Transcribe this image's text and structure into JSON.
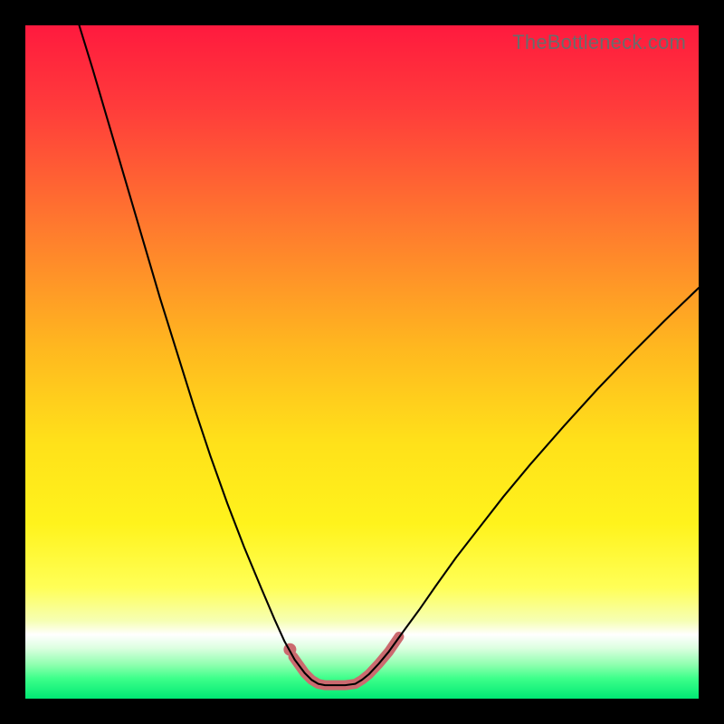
{
  "watermark": "TheBottleneck.com",
  "chart_data": {
    "type": "line",
    "title": "",
    "xlabel": "",
    "ylabel": "",
    "xlim": [
      0,
      100
    ],
    "ylim": [
      0,
      100
    ],
    "grid": false,
    "legend": false,
    "background_gradient_stops": [
      {
        "offset": 0.0,
        "color": "#ff1a3e"
      },
      {
        "offset": 0.12,
        "color": "#ff3b3b"
      },
      {
        "offset": 0.3,
        "color": "#ff7a2e"
      },
      {
        "offset": 0.48,
        "color": "#ffb81f"
      },
      {
        "offset": 0.62,
        "color": "#ffe11a"
      },
      {
        "offset": 0.74,
        "color": "#fff31c"
      },
      {
        "offset": 0.835,
        "color": "#ffff57"
      },
      {
        "offset": 0.885,
        "color": "#f6ffb5"
      },
      {
        "offset": 0.905,
        "color": "#ffffff"
      },
      {
        "offset": 0.925,
        "color": "#dcffe0"
      },
      {
        "offset": 0.95,
        "color": "#8dffae"
      },
      {
        "offset": 0.97,
        "color": "#3dff8a"
      },
      {
        "offset": 1.0,
        "color": "#00e874"
      }
    ],
    "series": [
      {
        "name": "bottleneck-curve",
        "color": "#000000",
        "width": 2.1,
        "data": [
          {
            "x": 8.0,
            "y": 100.0
          },
          {
            "x": 10.0,
            "y": 93.5
          },
          {
            "x": 12.5,
            "y": 85.0
          },
          {
            "x": 15.0,
            "y": 76.5
          },
          {
            "x": 17.5,
            "y": 68.0
          },
          {
            "x": 20.0,
            "y": 59.5
          },
          {
            "x": 22.5,
            "y": 51.5
          },
          {
            "x": 25.0,
            "y": 43.5
          },
          {
            "x": 27.5,
            "y": 36.0
          },
          {
            "x": 30.0,
            "y": 29.0
          },
          {
            "x": 32.5,
            "y": 22.5
          },
          {
            "x": 35.0,
            "y": 16.5
          },
          {
            "x": 37.0,
            "y": 11.8
          },
          {
            "x": 38.5,
            "y": 8.5
          },
          {
            "x": 40.0,
            "y": 5.8
          },
          {
            "x": 41.5,
            "y": 3.8
          },
          {
            "x": 42.5,
            "y": 2.8
          },
          {
            "x": 43.5,
            "y": 2.2
          },
          {
            "x": 44.5,
            "y": 2.0
          },
          {
            "x": 46.0,
            "y": 2.0
          },
          {
            "x": 47.5,
            "y": 2.0
          },
          {
            "x": 49.0,
            "y": 2.2
          },
          {
            "x": 50.0,
            "y": 2.8
          },
          {
            "x": 51.0,
            "y": 3.6
          },
          {
            "x": 52.5,
            "y": 5.2
          },
          {
            "x": 54.0,
            "y": 7.0
          },
          {
            "x": 56.0,
            "y": 9.8
          },
          {
            "x": 58.5,
            "y": 13.2
          },
          {
            "x": 61.0,
            "y": 16.8
          },
          {
            "x": 64.0,
            "y": 21.0
          },
          {
            "x": 67.5,
            "y": 25.5
          },
          {
            "x": 71.0,
            "y": 30.0
          },
          {
            "x": 75.0,
            "y": 34.8
          },
          {
            "x": 80.0,
            "y": 40.5
          },
          {
            "x": 85.0,
            "y": 46.0
          },
          {
            "x": 90.0,
            "y": 51.2
          },
          {
            "x": 95.0,
            "y": 56.2
          },
          {
            "x": 100.0,
            "y": 61.0
          }
        ]
      },
      {
        "name": "highlight-band",
        "color": "#cb6a6f",
        "width": 11,
        "linecap": "round",
        "data": [
          {
            "x": 39.8,
            "y": 6.2
          },
          {
            "x": 41.5,
            "y": 3.8
          },
          {
            "x": 42.5,
            "y": 2.8
          },
          {
            "x": 43.5,
            "y": 2.2
          },
          {
            "x": 44.5,
            "y": 2.0
          },
          {
            "x": 46.0,
            "y": 2.0
          },
          {
            "x": 47.5,
            "y": 2.0
          },
          {
            "x": 49.0,
            "y": 2.2
          },
          {
            "x": 50.0,
            "y": 2.8
          },
          {
            "x": 51.0,
            "y": 3.6
          },
          {
            "x": 52.5,
            "y": 5.2
          },
          {
            "x": 54.0,
            "y": 7.0
          },
          {
            "x": 55.5,
            "y": 9.2
          }
        ]
      },
      {
        "name": "highlight-dot",
        "type_hint": "scatter",
        "color": "#cb6a6f",
        "radius": 7,
        "data": [
          {
            "x": 39.3,
            "y": 7.3
          }
        ]
      }
    ]
  }
}
